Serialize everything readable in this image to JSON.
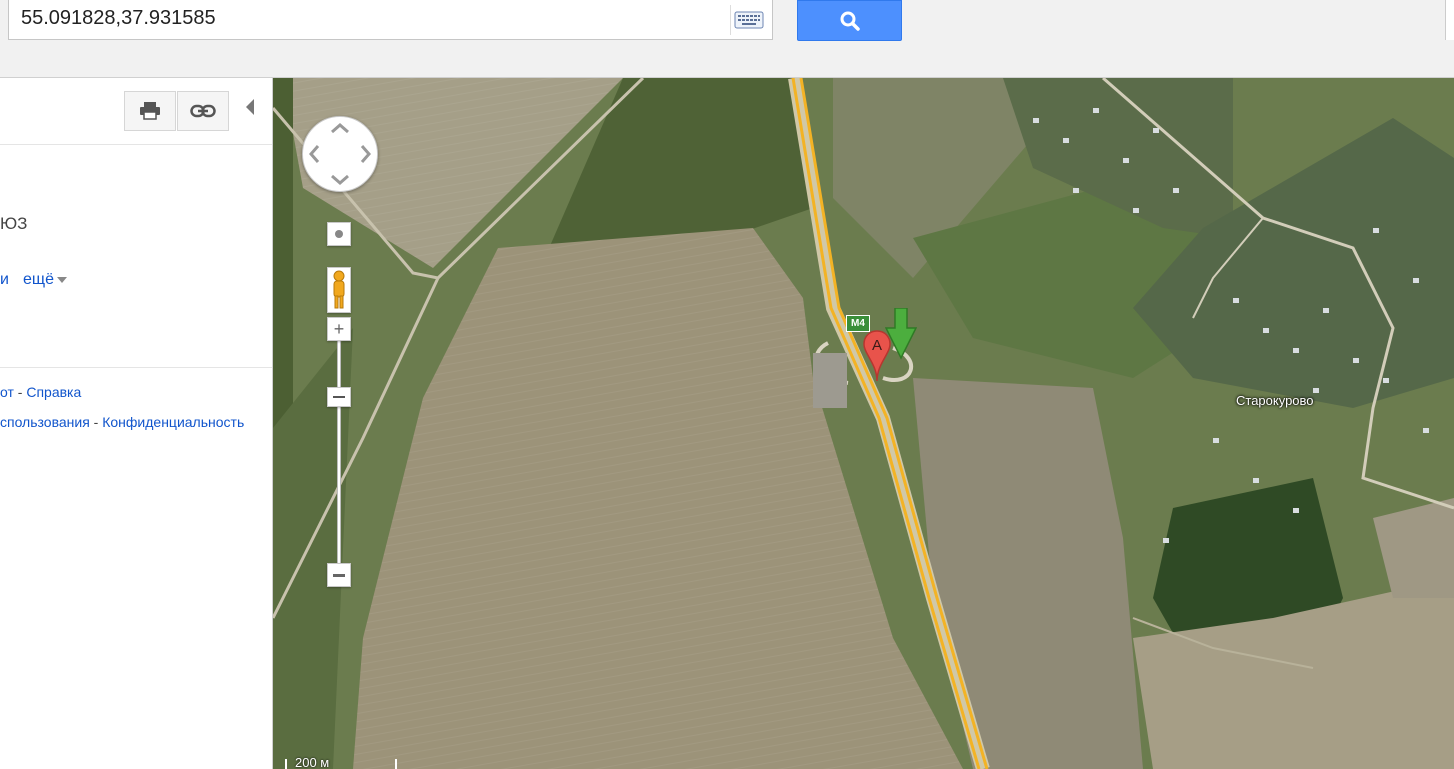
{
  "search": {
    "query": "55.091828,37.931585"
  },
  "icons": {
    "keyboard": "keyboard-icon",
    "search": "search-icon",
    "print": "print-icon",
    "link": "link-icon"
  },
  "panel": {
    "direction_text": "ЮЗ",
    "link_partial": "и",
    "more_label": "ещё",
    "footer_line1": {
      "a": "от",
      "sep": "-",
      "b": "Справка"
    },
    "footer_line2": {
      "a": "спользования",
      "sep": "-",
      "b": "Конфиденциальность"
    }
  },
  "map": {
    "scale_label": "200 м",
    "place_label": "Старокурово",
    "road_label": "M4",
    "marker_a_label": "A"
  },
  "colors": {
    "search_button": "#4d90fe",
    "link": "#1155cc",
    "marker_a": "#e8534b",
    "arrow_marker": "#4cae3e"
  }
}
